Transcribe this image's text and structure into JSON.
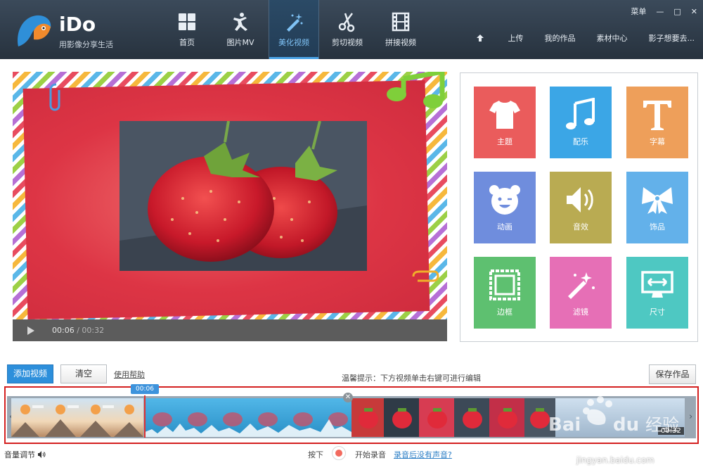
{
  "app": {
    "logo_text": "iDo",
    "slogan": "用影像分享生活"
  },
  "nav": [
    {
      "label": "首页",
      "icon": "grid-icon"
    },
    {
      "label": "图片MV",
      "icon": "dancer-icon"
    },
    {
      "label": "美化视频",
      "icon": "magic-wand-icon",
      "active": true
    },
    {
      "label": "剪切视频",
      "icon": "scissors-icon"
    },
    {
      "label": "拼接视频",
      "icon": "film-icon"
    }
  ],
  "window": {
    "menu_label": "菜单",
    "minimize": "—",
    "maximize": "□",
    "close": "✕"
  },
  "top_links": {
    "upload": "上传",
    "my_works": "我的作品",
    "material_center": "素材中心",
    "user": "影子想要去..."
  },
  "player": {
    "current_time": "00:06",
    "separator": " / ",
    "total_time": "00:32"
  },
  "effects": [
    {
      "label": "主题",
      "icon": "tshirt-icon",
      "color": "#ea5c5c"
    },
    {
      "label": "配乐",
      "icon": "music-note-icon",
      "color": "#3ba6e6"
    },
    {
      "label": "字幕",
      "icon": "text-T-icon",
      "color": "#ee9f5a"
    },
    {
      "label": "动画",
      "icon": "bear-face-icon",
      "color": "#6f8ddd"
    },
    {
      "label": "音效",
      "icon": "speaker-icon",
      "color": "#b9ab52"
    },
    {
      "label": "饰品",
      "icon": "bow-icon",
      "color": "#63b1ea"
    },
    {
      "label": "边框",
      "icon": "frame-icon",
      "color": "#5ec070"
    },
    {
      "label": "滤镜",
      "icon": "magic-wand-icon",
      "color": "#e66fb6"
    },
    {
      "label": "尺寸",
      "icon": "monitor-resize-icon",
      "color": "#4ec8c2"
    }
  ],
  "toolbar": {
    "add_video": "添加视频",
    "clear": "清空",
    "help": "使用帮助",
    "tip": "温馨提示：下方视频单击右键可进行编辑",
    "save": "保存作品"
  },
  "timeline": {
    "playhead_time": "00:06",
    "segment_duration": "00:32",
    "close_glyph": "✕",
    "left_arrow": "‹",
    "right_arrow": "›"
  },
  "bottom": {
    "volume": "音量调节",
    "press": "按下",
    "start_record": "开始录音",
    "no_sound": "录音后没有声音?",
    "watermark": "jingyan.baidu.com"
  }
}
